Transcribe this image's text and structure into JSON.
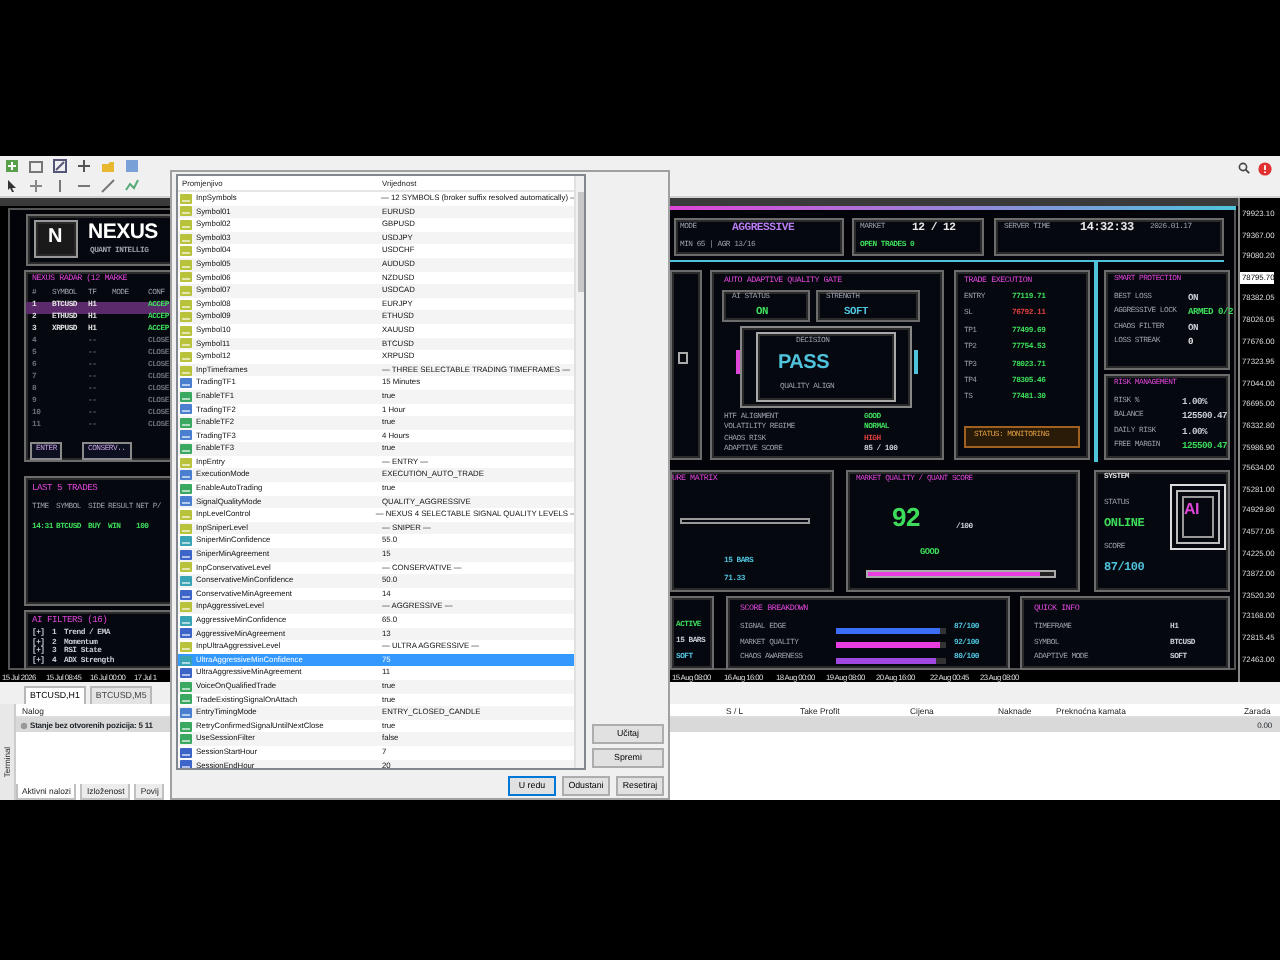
{
  "dashboard": {
    "brand": {
      "logo": "N",
      "title": "NEXUS",
      "subtitle": "QUANT INTELLIG"
    },
    "radar": {
      "title": "NEXUS RADAR  (12 MARKE",
      "columns": [
        "#",
        "SYMBOL",
        "TF",
        "MODE",
        "CONF"
      ],
      "rows": [
        {
          "cells": [
            "1",
            "BTCUSD",
            "H1",
            "ACCEP"
          ],
          "active": true,
          "selected": true
        },
        {
          "cells": [
            "2",
            "ETHUSD",
            "H1",
            "ACCEP"
          ],
          "active": true,
          "selected": false
        },
        {
          "cells": [
            "3",
            "XRPUSD",
            "H1",
            "ACCEP"
          ],
          "active": true,
          "selected": false
        },
        {
          "cells": [
            "4",
            "",
            "--",
            "CLOSE"
          ],
          "active": false,
          "selected": false
        },
        {
          "cells": [
            "5",
            "",
            "--",
            "CLOSE"
          ],
          "active": false,
          "selected": false
        },
        {
          "cells": [
            "6",
            "",
            "--",
            "CLOSE"
          ],
          "active": false,
          "selected": false
        },
        {
          "cells": [
            "7",
            "",
            "--",
            "CLOSE"
          ],
          "active": false,
          "selected": false
        },
        {
          "cells": [
            "8",
            "",
            "--",
            "CLOSE"
          ],
          "active": false,
          "selected": false
        },
        {
          "cells": [
            "9",
            "",
            "--",
            "CLOSE"
          ],
          "active": false,
          "selected": false
        },
        {
          "cells": [
            "10",
            "",
            "--",
            "CLOSE"
          ],
          "active": false,
          "selected": false
        },
        {
          "cells": [
            "11",
            "",
            "--",
            "CLOSE"
          ],
          "active": false,
          "selected": false
        }
      ],
      "buttons": [
        "ENTER",
        "CONSERV.."
      ]
    },
    "trades": {
      "title": "LAST 5 TRADES",
      "columns": [
        "TIME",
        "SYMBOL",
        "SIDE",
        "RESULT",
        "NET P/"
      ],
      "rows": [
        [
          "14:31",
          "BTCUSD",
          "BUY",
          "WIN",
          "100"
        ]
      ]
    },
    "filters": {
      "title": "AI FILTERS  (16)",
      "items": [
        {
          "mark": "[+]",
          "num": "1",
          "label": "Trend / EMA"
        },
        {
          "mark": "[+]",
          "num": "2",
          "label": "Momentum"
        },
        {
          "mark": "[+]",
          "num": "3",
          "label": "RSI State"
        },
        {
          "mark": "[+]",
          "num": "4",
          "label": "ADX Strength"
        }
      ]
    },
    "mode": {
      "label": "MODE",
      "value": "AGGRESSIVE",
      "detail": "MIN 65 | AGR 13/16"
    },
    "market": {
      "label": "MARKET",
      "value": "12 / 12",
      "detail": "OPEN TRADES 0"
    },
    "server": {
      "label": "SERVER TIME",
      "time": "14:32:33",
      "date": "2026.01.17"
    },
    "gate": {
      "title": "AUTO ADAPTIVE QUALITY GATE",
      "status_label": "AI STATUS",
      "status": "ON",
      "strength_label": "STRENGTH",
      "strength": "SOFT",
      "decision_label": "DECISION",
      "decision": "PASS",
      "caption": "QUALITY ALIGN",
      "rows": [
        {
          "label": "HTF ALIGNMENT",
          "value": "GOOD",
          "color": "#3ddc5a"
        },
        {
          "label": "VOLATILITY REGIME",
          "value": "NORMAL",
          "color": "#3ddc5a"
        },
        {
          "label": "CHAOS RISK",
          "value": "HIGH",
          "color": "#e04040"
        },
        {
          "label": "ADAPTIVE SCORE",
          "value": "85 / 100",
          "color": "#c8ccd4"
        }
      ]
    },
    "execution": {
      "title": "TRADE EXECUTION",
      "rows": [
        {
          "label": "ENTRY",
          "value": "77119.71",
          "color": "#3ddc5a"
        },
        {
          "label": "SL",
          "value": "76792.11",
          "color": "#e04040"
        },
        {
          "label": "TP1",
          "value": "77499.69",
          "color": "#3ddc5a"
        },
        {
          "label": "TP2",
          "value": "77754.53",
          "color": "#3ddc5a"
        },
        {
          "label": "TP3",
          "value": "78023.71",
          "color": "#3ddc5a"
        },
        {
          "label": "TP4",
          "value": "78305.46",
          "color": "#3ddc5a"
        },
        {
          "label": "TS",
          "value": "77481.30",
          "color": "#3ddc5a"
        }
      ],
      "status": "STATUS: MONITORING"
    },
    "protection": {
      "title": "SMART PROTECTION",
      "rows": [
        {
          "label": "BEST LOSS",
          "value": "ON",
          "color": "#c8ccd4"
        },
        {
          "label": "AGGRESSIVE LOCK",
          "value": "ARMED 0/2",
          "color": "#3ddc5a"
        },
        {
          "label": "CHAOS FILTER",
          "value": "ON",
          "color": "#c8ccd4"
        },
        {
          "label": "LOSS STREAK",
          "value": "0",
          "color": "#e8e8e8"
        }
      ]
    },
    "risk": {
      "title": "RISK MANAGEMENT",
      "rows": [
        {
          "label": "RISK %",
          "value": "1.00%",
          "color": "#c8ccd4"
        },
        {
          "label": "BALANCE",
          "value": "125500.47",
          "color": "#c8ccd4"
        },
        {
          "label": "DAILY RISK",
          "value": "1.00%",
          "color": "#c8ccd4"
        },
        {
          "label": "FREE MARGIN",
          "value": "125500.47",
          "color": "#3ddc5a"
        }
      ]
    },
    "matrix": {
      "title": "URE MATRIX",
      "values": [
        "15 BARS",
        "71.33"
      ]
    },
    "quality": {
      "title": "MARKET QUALITY / QUANT SCORE",
      "score": "92",
      "max": "/100",
      "grade": "GOOD",
      "level": 0.93
    },
    "system": {
      "title": "SYSTEM",
      "status_label": "STATUS",
      "status": "ONLINE",
      "score_label": "SCORE",
      "score": "87/100",
      "logo": "AI"
    },
    "side": [
      {
        "value": "ACTIVE",
        "color": "#3ddc5a"
      },
      {
        "value": "15 BARS",
        "color": "#c8ccd4"
      },
      {
        "value": "SOFT",
        "color": "#4fc3dc"
      }
    ],
    "breakdown": {
      "title": "SCORE BREAKDOWN",
      "rows": [
        {
          "label": "SIGNAL EDGE",
          "level": 0.95,
          "value": "87/100",
          "color": "#3b6ef5"
        },
        {
          "label": "MARKET QUALITY",
          "level": 0.95,
          "value": "92/100",
          "color": "#e83ee0"
        },
        {
          "label": "CHAOS AWARENESS",
          "level": 0.9,
          "value": "80/100",
          "color": "#a048e0"
        }
      ]
    },
    "quick": {
      "title": "QUICK INFO",
      "rows": [
        {
          "label": "TIMEFRAME",
          "value": "H1"
        },
        {
          "label": "SYMBOL",
          "value": "BTCUSD"
        },
        {
          "label": "ADAPTIVE MODE",
          "value": "SOFT"
        }
      ]
    }
  },
  "price_axis": [
    {
      "label": "79923.10",
      "current": false
    },
    {
      "label": "79367.00",
      "current": false
    },
    {
      "label": "79080.20",
      "current": false
    },
    {
      "label": "78795.70",
      "current": true
    },
    {
      "label": "78382.05",
      "current": false
    },
    {
      "label": "78026.05",
      "current": false
    },
    {
      "label": "77676.00",
      "current": false
    },
    {
      "label": "77323.95",
      "current": false
    },
    {
      "label": "77044.00",
      "current": false
    },
    {
      "label": "76695.00",
      "current": false
    },
    {
      "label": "76332.80",
      "current": false
    },
    {
      "label": "75986.90",
      "current": false
    },
    {
      "label": "75634.00",
      "current": false
    },
    {
      "label": "75281.00",
      "current": false
    },
    {
      "label": "74929.80",
      "current": false
    },
    {
      "label": "74577.05",
      "current": false
    },
    {
      "label": "74225.00",
      "current": false
    },
    {
      "label": "73872.00",
      "current": false
    },
    {
      "label": "73520.30",
      "current": false
    },
    {
      "label": "73168.00",
      "current": false
    },
    {
      "label": "72815.45",
      "current": false
    },
    {
      "label": "72463.00",
      "current": false
    }
  ],
  "time_axis": [
    "15 Jul 2026",
    "15 Jul 08:45",
    "16 Jul 00:00",
    "17 Jul 1",
    "15 Aug 08:00",
    "16 Aug 16:00",
    "18 Aug 00:00",
    "19 Aug 08:00",
    "20 Aug 16:00",
    "22 Aug 00:45",
    "23 Aug 08:00"
  ],
  "chart_tabs": [
    {
      "label": "BTCUSD,H1",
      "selected": true
    },
    {
      "label": "BTCUSD,M5",
      "selected": false
    }
  ],
  "terminal": {
    "side_label": "Terminal",
    "columns": [
      "Nalog",
      "S / L",
      "Take Profit",
      "Cijena",
      "Naknade",
      "Preknoćna kamata",
      "Zarada"
    ],
    "balance": "Stanje bez otvorenih pozicija: 5 11",
    "profit": "0.00",
    "tabs": [
      {
        "label": "Aktivni nalozi",
        "selected": true
      },
      {
        "label": "Izloženost",
        "selected": false
      },
      {
        "label": "Povij",
        "selected": false
      }
    ]
  },
  "dialog": {
    "columns": [
      "Promjenjivo",
      "Vrijednost"
    ],
    "rows": [
      {
        "name": "InpSymbols",
        "value": "— 12 SYMBOLS (broker suffix resolved automatically) —",
        "kind": "string",
        "selected": false
      },
      {
        "name": "Symbol01",
        "value": "EURUSD",
        "kind": "string",
        "selected": false
      },
      {
        "name": "Symbol02",
        "value": "GBPUSD",
        "kind": "string",
        "selected": false
      },
      {
        "name": "Symbol03",
        "value": "USDJPY",
        "kind": "string",
        "selected": false
      },
      {
        "name": "Symbol04",
        "value": "USDCHF",
        "kind": "string",
        "selected": false
      },
      {
        "name": "Symbol05",
        "value": "AUDUSD",
        "kind": "string",
        "selected": false
      },
      {
        "name": "Symbol06",
        "value": "NZDUSD",
        "kind": "string",
        "selected": false
      },
      {
        "name": "Symbol07",
        "value": "USDCAD",
        "kind": "string",
        "selected": false
      },
      {
        "name": "Symbol08",
        "value": "EURJPY",
        "kind": "string",
        "selected": false
      },
      {
        "name": "Symbol09",
        "value": "ETHUSD",
        "kind": "string",
        "selected": false
      },
      {
        "name": "Symbol10",
        "value": "XAUUSD",
        "kind": "string",
        "selected": false
      },
      {
        "name": "Symbol11",
        "value": "BTCUSD",
        "kind": "string",
        "selected": false
      },
      {
        "name": "Symbol12",
        "value": "XRPUSD",
        "kind": "string",
        "selected": false
      },
      {
        "name": "InpTimeframes",
        "value": "— THREE SELECTABLE TRADING TIMEFRAMES —",
        "kind": "string",
        "selected": false
      },
      {
        "name": "TradingTF1",
        "value": "15 Minutes",
        "kind": "enum",
        "selected": false
      },
      {
        "name": "EnableTF1",
        "value": "true",
        "kind": "bool",
        "selected": false
      },
      {
        "name": "TradingTF2",
        "value": "1 Hour",
        "kind": "enum",
        "selected": false
      },
      {
        "name": "EnableTF2",
        "value": "true",
        "kind": "bool",
        "selected": false
      },
      {
        "name": "TradingTF3",
        "value": "4 Hours",
        "kind": "enum",
        "selected": false
      },
      {
        "name": "EnableTF3",
        "value": "true",
        "kind": "bool",
        "selected": false
      },
      {
        "name": "InpEntry",
        "value": "— ENTRY —",
        "kind": "string",
        "selected": false
      },
      {
        "name": "ExecutionMode",
        "value": "EXECUTION_AUTO_TRADE",
        "kind": "enum",
        "selected": false
      },
      {
        "name": "EnableAutoTrading",
        "value": "true",
        "kind": "bool",
        "selected": false
      },
      {
        "name": "SignalQualityMode",
        "value": "QUALITY_AGGRESSIVE",
        "kind": "enum",
        "selected": false
      },
      {
        "name": "InpLevelControl",
        "value": "— NEXUS 4 SELECTABLE SIGNAL QUALITY LEVELS —",
        "kind": "string",
        "selected": false
      },
      {
        "name": "InpSniperLevel",
        "value": "— SNIPER —",
        "kind": "string",
        "selected": false
      },
      {
        "name": "SniperMinConfidence",
        "value": "55.0",
        "kind": "double",
        "selected": false
      },
      {
        "name": "SniperMinAgreement",
        "value": "15",
        "kind": "int",
        "selected": false
      },
      {
        "name": "InpConservativeLevel",
        "value": "— CONSERVATIVE —",
        "kind": "string",
        "selected": false
      },
      {
        "name": "ConservativeMinConfidence",
        "value": "50.0",
        "kind": "double",
        "selected": false
      },
      {
        "name": "ConservativeMinAgreement",
        "value": "14",
        "kind": "int",
        "selected": false
      },
      {
        "name": "InpAggressiveLevel",
        "value": "— AGGRESSIVE —",
        "kind": "string",
        "selected": false
      },
      {
        "name": "AggressiveMinConfidence",
        "value": "65.0",
        "kind": "double",
        "selected": false
      },
      {
        "name": "AggressiveMinAgreement",
        "value": "13",
        "kind": "int",
        "selected": false
      },
      {
        "name": "InpUltraAggressiveLevel",
        "value": "— ULTRA AGGRESSIVE —",
        "kind": "string",
        "selected": false
      },
      {
        "name": "UltraAggressiveMinConfidence",
        "value": "75",
        "kind": "double",
        "selected": true
      },
      {
        "name": "UltraAggressiveMinAgreement",
        "value": "11",
        "kind": "int",
        "selected": false
      },
      {
        "name": "VoiceOnQualifiedTrade",
        "value": "true",
        "kind": "bool",
        "selected": false
      },
      {
        "name": "TradeExistingSignalOnAttach",
        "value": "true",
        "kind": "bool",
        "selected": false
      },
      {
        "name": "EntryTimingMode",
        "value": "ENTRY_CLOSED_CANDLE",
        "kind": "enum",
        "selected": false
      },
      {
        "name": "RetryConfirmedSignalUntilNextClose",
        "value": "true",
        "kind": "bool",
        "selected": false
      },
      {
        "name": "UseSessionFilter",
        "value": "false",
        "kind": "bool",
        "selected": false
      },
      {
        "name": "SessionStartHour",
        "value": "7",
        "kind": "int",
        "selected": false
      },
      {
        "name": "SessionEndHour",
        "value": "20",
        "kind": "int",
        "selected": false
      }
    ],
    "side_buttons": [
      "Učitaj",
      "Spremi"
    ],
    "buttons": [
      "U redu",
      "Odustani",
      "Resetiraj"
    ]
  }
}
